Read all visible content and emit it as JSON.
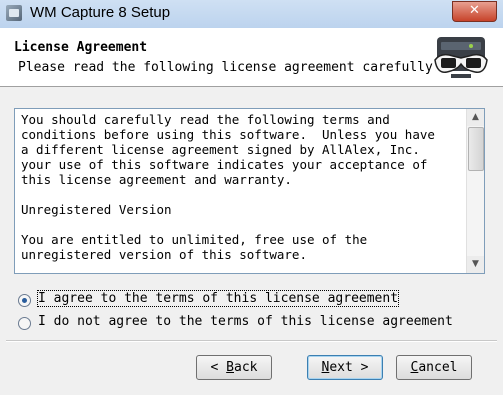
{
  "window": {
    "title": "WM Capture 8 Setup",
    "close_label": "✕"
  },
  "header": {
    "title": "License Agreement",
    "subtitle": "Please read the following license agreement carefully."
  },
  "license": {
    "paragraphs": [
      "You should carefully read the following terms and\nconditions before using this software.  Unless you have\na different license agreement signed by AllAlex, Inc.\nyour use of this software indicates your acceptance of\nthis license agreement and warranty.",
      "Unregistered Version",
      "You are entitled to unlimited, free use of the\nunregistered version of this software."
    ]
  },
  "options": {
    "agree_label": "I agree to the terms of this license agreement",
    "disagree_label": "I do not agree to the terms of this license agreement",
    "selected": "agree"
  },
  "buttons": {
    "back_prefix": "< ",
    "back_key": "B",
    "back_rest": "ack",
    "next_key": "N",
    "next_rest": "ext >",
    "cancel_key": "C",
    "cancel_rest": "ancel"
  },
  "colors": {
    "title_bar": "#cfe0f3",
    "close_button": "#c7432a",
    "default_button_border": "#3c7fb1"
  }
}
